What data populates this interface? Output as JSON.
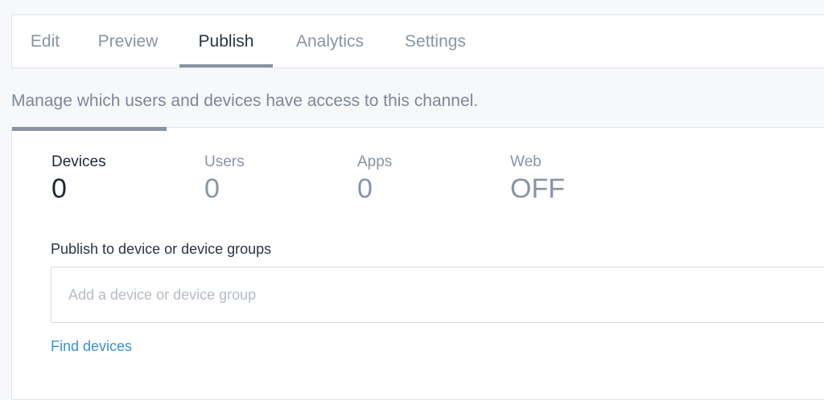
{
  "tabs": [
    {
      "label": "Edit"
    },
    {
      "label": "Preview"
    },
    {
      "label": "Publish",
      "active": true
    },
    {
      "label": "Analytics"
    },
    {
      "label": "Settings"
    }
  ],
  "subtitle": "Manage which users and devices have access to this channel.",
  "stats": [
    {
      "label": "Devices",
      "value": "0",
      "active": true
    },
    {
      "label": "Users",
      "value": "0"
    },
    {
      "label": "Apps",
      "value": "0"
    },
    {
      "label": "Web",
      "value": "OFF"
    }
  ],
  "publish": {
    "label": "Publish to device or device groups",
    "placeholder": "Add a device or device group",
    "value": "",
    "find_link": "Find devices"
  },
  "colors": {
    "accent_link": "#3a8fd6",
    "active_indicator": "#8892a0",
    "muted_text": "#8a94a3"
  }
}
